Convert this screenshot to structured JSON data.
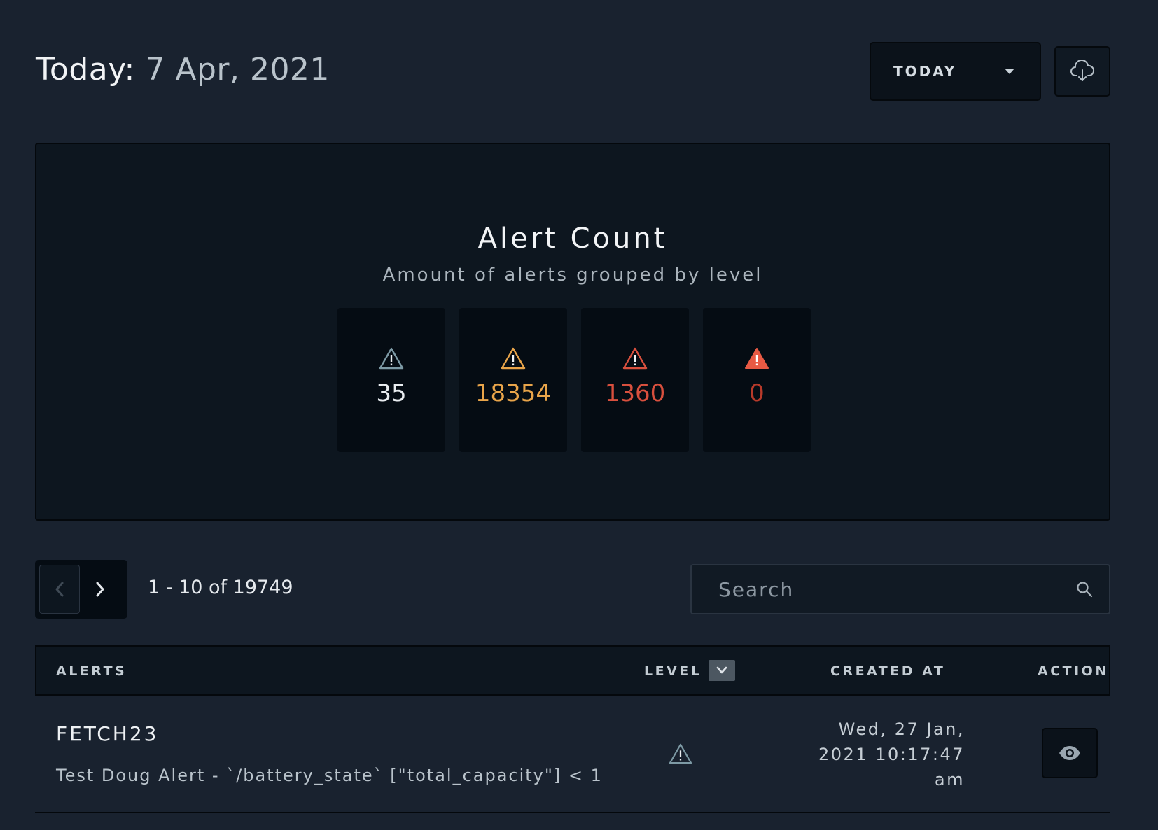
{
  "header": {
    "title_label": "Today:",
    "title_date": "7 Apr, 2021",
    "range_select": "TODAY",
    "download_icon": "cloud-download-icon"
  },
  "alert_count": {
    "title": "Alert Count",
    "subtitle": "Amount of alerts grouped by level",
    "tiles": [
      {
        "value": "35",
        "color": "#e9edf0",
        "icon_color": "#7d9aa5"
      },
      {
        "value": "18354",
        "color": "#e9a54a",
        "icon_color": "#e9a54a"
      },
      {
        "value": "1360",
        "color": "#d9503e",
        "icon_color": "#d9503e"
      },
      {
        "value": "0",
        "color": "#b83a2a",
        "icon_color": "#e85a44"
      }
    ]
  },
  "pagination": {
    "text": "1 - 10 of 19749"
  },
  "search": {
    "placeholder": "Search"
  },
  "table": {
    "columns": {
      "alerts": "ALERTS",
      "level": "LEVEL",
      "created_at": "CREATED AT",
      "action": "ACTION"
    },
    "rows": [
      {
        "title": "FETCH23",
        "description": "Test Doug Alert - `/battery_state` [\"total_capacity\"] < 1",
        "created_line1": "Wed, 27 Jan,",
        "created_line2": "2021 10:17:47",
        "created_line3": "am"
      }
    ]
  }
}
